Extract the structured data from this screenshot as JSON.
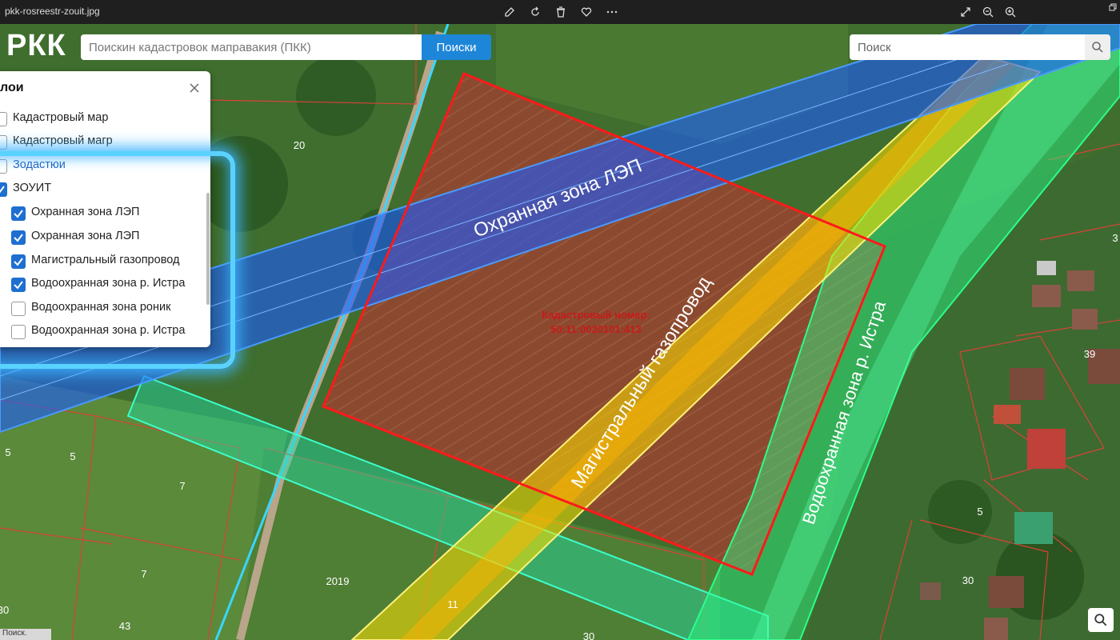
{
  "window": {
    "filename": "pkk-rosreestr-zouit.jpg"
  },
  "app": {
    "logo": "РКК"
  },
  "search": {
    "placeholder": "Поискин кадастровок маправакия (ПКК)",
    "button_label": "Поиски",
    "right_placeholder": "Поиск"
  },
  "layers_panel": {
    "title": "лои",
    "items": [
      {
        "label": "Кадастровый мар",
        "checked": false
      },
      {
        "label": "Кадастровый магр",
        "checked": false
      },
      {
        "label": "Зодастюи",
        "checked": false
      },
      {
        "label": "ЗОУИТ",
        "checked": true
      },
      {
        "label": "Охранная зона ЛЭП",
        "checked": true
      },
      {
        "label": "Охранная зона ЛЭП",
        "checked": true
      },
      {
        "label": "Магистральный газопровод",
        "checked": true
      },
      {
        "label": "Водоохранная зона р. Истра",
        "checked": true
      },
      {
        "label": "Водоохранная зона роник",
        "checked": false
      },
      {
        "label": "Водоохранная зона р. Истра",
        "checked": false
      }
    ]
  },
  "map": {
    "zone_labels": {
      "power_line": "Охранная зона ЛЭП",
      "gas_pipeline": "Магистральный газопровод",
      "water_zone": "Водоохранная зона р. Истра"
    },
    "cadastral_label_line1": "Кадастровый номер:",
    "cadastral_label_line2": "50:11:0020101:413",
    "plot_numbers": [
      "20",
      "5",
      "5",
      "7",
      "7",
      "43",
      "2019",
      "11",
      "30",
      "39",
      "5",
      "30",
      "30",
      "3"
    ],
    "colors": {
      "plot_border": "#ff1a1a",
      "power_zone": "#1a5aff",
      "gas_zone": "#ffe000",
      "water_zone": "#2aff8a",
      "road_zone": "#2ad0ff"
    }
  },
  "status": {
    "chip_text": "Поиск."
  }
}
